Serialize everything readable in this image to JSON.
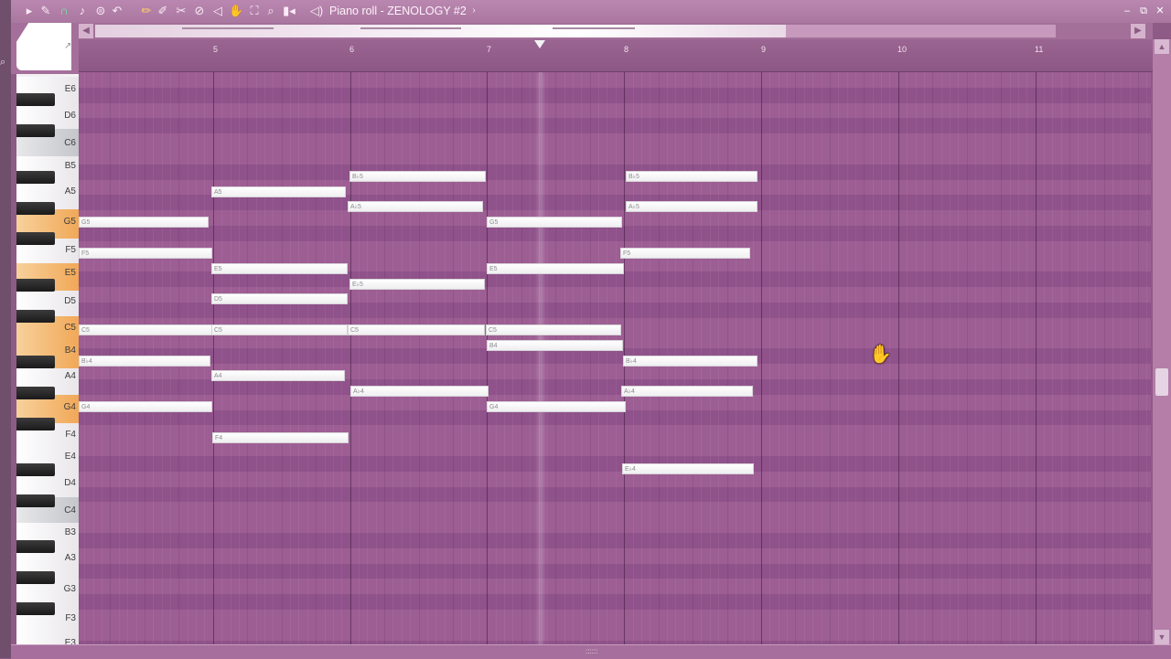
{
  "window": {
    "title": "Piano roll - ZENOLOGY #2"
  },
  "toolbar": {
    "icons": [
      "play-arrow-icon",
      "wrench-icon",
      "magnet-icon",
      "note-icon",
      "menu-icon",
      "undo-icon",
      "pencil-icon",
      "brush-icon",
      "delete-icon",
      "mute-icon",
      "slice-icon",
      "select-icon",
      "zoom-icon",
      "playback-icon",
      "speaker-icon"
    ]
  },
  "ruler": {
    "bars": [
      "5",
      "6",
      "7",
      "8",
      "9",
      "10",
      "11"
    ]
  },
  "keyboard": {
    "labels": [
      "E6",
      "D6",
      "C6",
      "B5",
      "A5",
      "G5",
      "F5",
      "E5",
      "D5",
      "C5",
      "B4",
      "A4",
      "G4",
      "F4",
      "E4",
      "D4",
      "C4",
      "B3",
      "A3",
      "G3",
      "F3",
      "E3"
    ]
  },
  "notes": [
    {
      "label": "G5"
    },
    {
      "label": "F5"
    },
    {
      "label": "C5"
    },
    {
      "label": "B♭4"
    },
    {
      "label": "G4"
    },
    {
      "label": "A5"
    },
    {
      "label": "E5"
    },
    {
      "label": "D5"
    },
    {
      "label": "C5"
    },
    {
      "label": "A4"
    },
    {
      "label": "F4"
    },
    {
      "label": "B♭5"
    },
    {
      "label": "A♭5"
    },
    {
      "label": "E♭5"
    },
    {
      "label": "C5"
    },
    {
      "label": "A♭4"
    },
    {
      "label": "G5"
    },
    {
      "label": "E5"
    },
    {
      "label": "C5"
    },
    {
      "label": "B4"
    },
    {
      "label": "G4"
    },
    {
      "label": "B♭5"
    },
    {
      "label": "A♭5"
    },
    {
      "label": "F5"
    },
    {
      "label": "B♭4"
    },
    {
      "label": "A♭4"
    },
    {
      "label": "E♭4"
    }
  ],
  "colors": {
    "grid": "#9d5e93",
    "accent_key": "#f1a858",
    "note": "#ffffff"
  }
}
